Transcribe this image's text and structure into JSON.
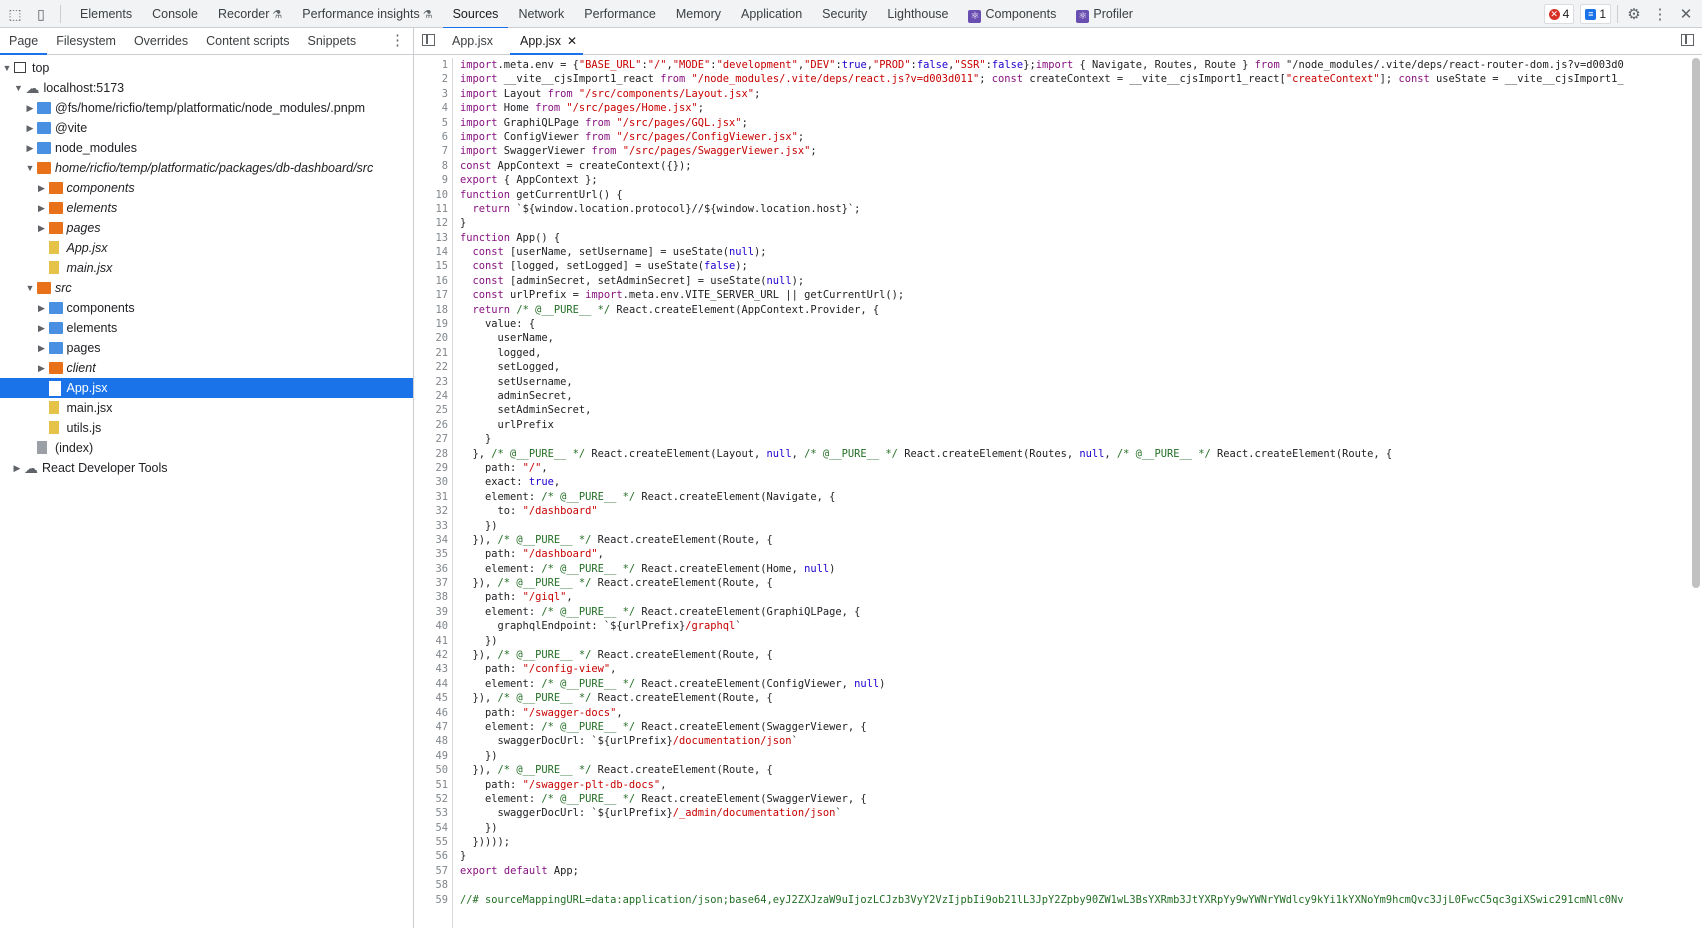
{
  "toolbar": {
    "tabs": [
      {
        "label": "Elements",
        "flask": false,
        "react": false
      },
      {
        "label": "Console",
        "flask": false,
        "react": false
      },
      {
        "label": "Recorder",
        "flask": true,
        "react": false
      },
      {
        "label": "Performance insights",
        "flask": true,
        "react": false
      },
      {
        "label": "Sources",
        "flask": false,
        "react": false,
        "active": true
      },
      {
        "label": "Network",
        "flask": false,
        "react": false
      },
      {
        "label": "Performance",
        "flask": false,
        "react": false
      },
      {
        "label": "Memory",
        "flask": false,
        "react": false
      },
      {
        "label": "Application",
        "flask": false,
        "react": false
      },
      {
        "label": "Security",
        "flask": false,
        "react": false
      },
      {
        "label": "Lighthouse",
        "flask": false,
        "react": false
      },
      {
        "label": "Components",
        "flask": false,
        "react": true
      },
      {
        "label": "Profiler",
        "flask": false,
        "react": true
      }
    ],
    "errors_count": "4",
    "messages_count": "1"
  },
  "navigator": {
    "subtabs": [
      "Page",
      "Filesystem",
      "Overrides",
      "Content scripts",
      "Snippets"
    ],
    "tree": [
      {
        "label": "top",
        "depth": 0,
        "icon": "frame",
        "tri": "down"
      },
      {
        "label": "localhost:5173",
        "depth": 1,
        "icon": "cloud",
        "tri": "down"
      },
      {
        "label": "@fs/home/ricfio/temp/platformatic/node_modules/.pnpm",
        "depth": 2,
        "icon": "folder-blue",
        "tri": "right"
      },
      {
        "label": "@vite",
        "depth": 2,
        "icon": "folder-blue",
        "tri": "right"
      },
      {
        "label": "node_modules",
        "depth": 2,
        "icon": "folder-blue",
        "tri": "right"
      },
      {
        "label": "home/ricfio/temp/platformatic/packages/db-dashboard/src",
        "depth": 2,
        "icon": "folder-orange",
        "tri": "down",
        "italic": true
      },
      {
        "label": "components",
        "depth": 3,
        "icon": "folder-orange",
        "tri": "right",
        "italic": true
      },
      {
        "label": "elements",
        "depth": 3,
        "icon": "folder-orange",
        "tri": "right",
        "italic": true
      },
      {
        "label": "pages",
        "depth": 3,
        "icon": "folder-orange",
        "tri": "right",
        "italic": true
      },
      {
        "label": "App.jsx",
        "depth": 3,
        "icon": "file-yellow",
        "tri": "",
        "italic": true
      },
      {
        "label": "main.jsx",
        "depth": 3,
        "icon": "file-yellow",
        "tri": "",
        "italic": true
      },
      {
        "label": "src",
        "depth": 2,
        "icon": "folder-orange",
        "tri": "down",
        "italic": true
      },
      {
        "label": "components",
        "depth": 3,
        "icon": "folder-blue",
        "tri": "right"
      },
      {
        "label": "elements",
        "depth": 3,
        "icon": "folder-blue",
        "tri": "right"
      },
      {
        "label": "pages",
        "depth": 3,
        "icon": "folder-blue",
        "tri": "right"
      },
      {
        "label": "client",
        "depth": 3,
        "icon": "folder-orange",
        "tri": "right",
        "italic": true
      },
      {
        "label": "App.jsx",
        "depth": 3,
        "icon": "file-white",
        "tri": "",
        "selected": true
      },
      {
        "label": "main.jsx",
        "depth": 3,
        "icon": "file-yellow",
        "tri": ""
      },
      {
        "label": "utils.js",
        "depth": 3,
        "icon": "file-yellow",
        "tri": ""
      },
      {
        "label": "(index)",
        "depth": 2,
        "icon": "file-gray",
        "tri": ""
      },
      {
        "label": "React Developer Tools",
        "depth": 1,
        "icon": "cloud",
        "tri": "right",
        "rootlevel": true
      }
    ]
  },
  "editor": {
    "tabs": [
      {
        "label": "App.jsx",
        "active": false
      },
      {
        "label": "App.jsx",
        "active": true,
        "closable": true
      }
    ],
    "lines": [
      "import.meta.env = {\"BASE_URL\":\"/\",\"MODE\":\"development\",\"DEV\":true,\"PROD\":false,\"SSR\":false};import { Navigate, Routes, Route } from \"/node_modules/.vite/deps/react-router-dom.js?v=d003d0",
      "import __vite__cjsImport1_react from \"/node_modules/.vite/deps/react.js?v=d003d011\"; const createContext = __vite__cjsImport1_react[\"createContext\"]; const useState = __vite__cjsImport1_",
      "import Layout from \"/src/components/Layout.jsx\";",
      "import Home from \"/src/pages/Home.jsx\";",
      "import GraphiQLPage from \"/src/pages/GQL.jsx\";",
      "import ConfigViewer from \"/src/pages/ConfigViewer.jsx\";",
      "import SwaggerViewer from \"/src/pages/SwaggerViewer.jsx\";",
      "const AppContext = createContext({});",
      "export { AppContext };",
      "function getCurrentUrl() {",
      "  return `${window.location.protocol}//${window.location.host}`;",
      "}",
      "function App() {",
      "  const [userName, setUsername] = useState(null);",
      "  const [logged, setLogged] = useState(false);",
      "  const [adminSecret, setAdminSecret] = useState(null);",
      "  const urlPrefix = import.meta.env.VITE_SERVER_URL || getCurrentUrl();",
      "  return /* @__PURE__ */ React.createElement(AppContext.Provider, {",
      "    value: {",
      "      userName,",
      "      logged,",
      "      setLogged,",
      "      setUsername,",
      "      adminSecret,",
      "      setAdminSecret,",
      "      urlPrefix",
      "    }",
      "  }, /* @__PURE__ */ React.createElement(Layout, null, /* @__PURE__ */ React.createElement(Routes, null, /* @__PURE__ */ React.createElement(Route, {",
      "    path: \"/\",",
      "    exact: true,",
      "    element: /* @__PURE__ */ React.createElement(Navigate, {",
      "      to: \"/dashboard\"",
      "    })",
      "  }), /* @__PURE__ */ React.createElement(Route, {",
      "    path: \"/dashboard\",",
      "    element: /* @__PURE__ */ React.createElement(Home, null)",
      "  }), /* @__PURE__ */ React.createElement(Route, {",
      "    path: \"/giql\",",
      "    element: /* @__PURE__ */ React.createElement(GraphiQLPage, {",
      "      graphqlEndpoint: `${urlPrefix}/graphql`",
      "    })",
      "  }), /* @__PURE__ */ React.createElement(Route, {",
      "    path: \"/config-view\",",
      "    element: /* @__PURE__ */ React.createElement(ConfigViewer, null)",
      "  }), /* @__PURE__ */ React.createElement(Route, {",
      "    path: \"/swagger-docs\",",
      "    element: /* @__PURE__ */ React.createElement(SwaggerViewer, {",
      "      swaggerDocUrl: `${urlPrefix}/documentation/json`",
      "    })",
      "  }), /* @__PURE__ */ React.createElement(Route, {",
      "    path: \"/swagger-plt-db-docs\",",
      "    element: /* @__PURE__ */ React.createElement(SwaggerViewer, {",
      "      swaggerDocUrl: `${urlPrefix}/_admin/documentation/json`",
      "    })",
      "  }))));",
      "}",
      "export default App;",
      "",
      "//# sourceMappingURL=data:application/json;base64,eyJ2ZXJzaW9uIjozLCJzb3VyY2VzIjpbIi9ob21lL3JpY2Zpby90ZW1wL3BsYXRmb3JtYXRpYy9wYWNrYWdlcy9kYi1kYXNoYm9hcmQvc3JjL0FwcC5qc3giXSwic291cmNlc0Nv"
    ]
  }
}
